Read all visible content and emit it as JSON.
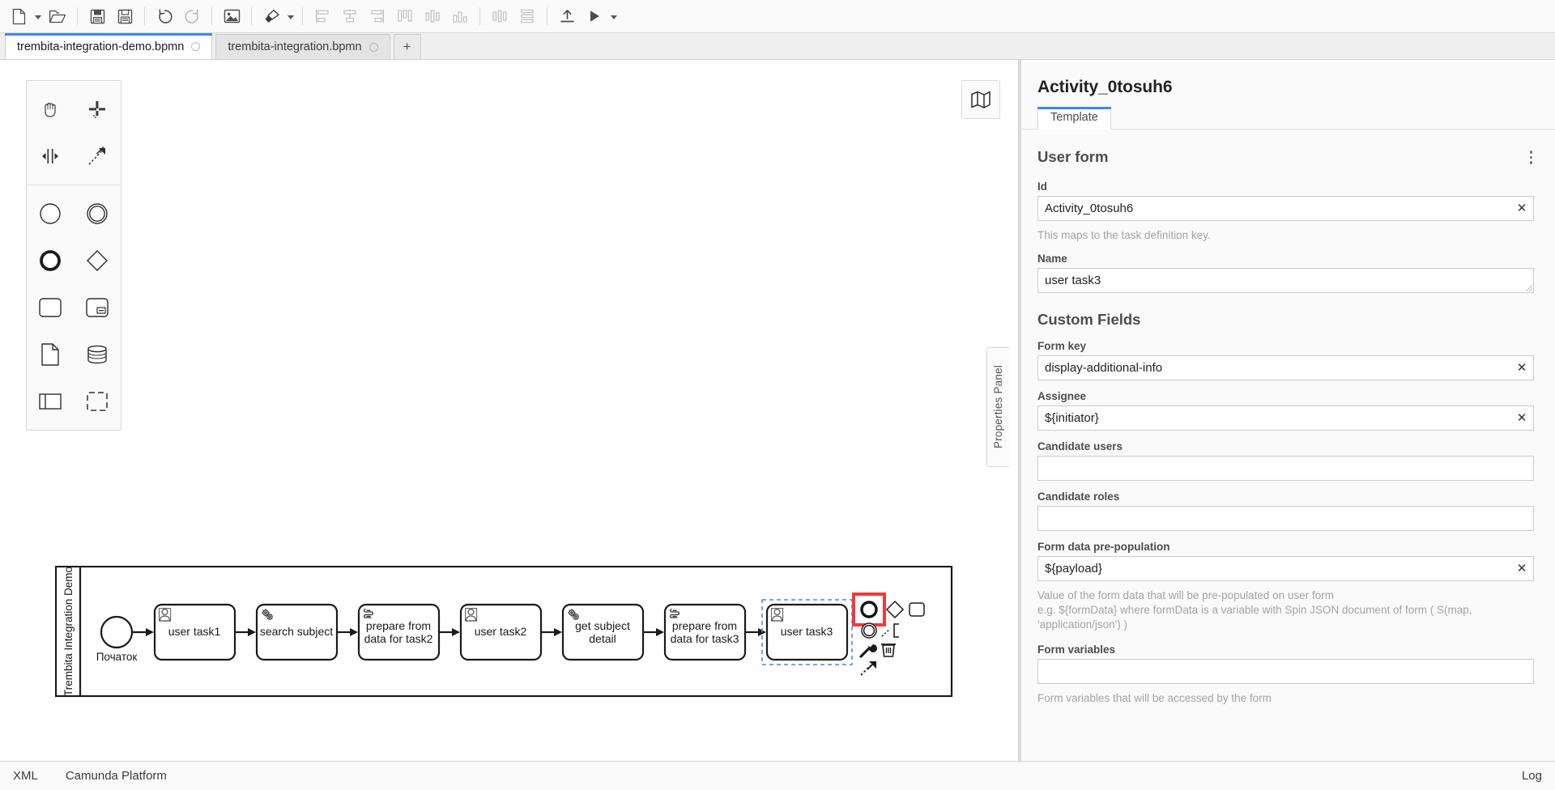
{
  "toolbar": {
    "buttons": [
      {
        "name": "new-file-button",
        "icon": "new-file-icon",
        "label": "New file"
      },
      {
        "name": "new-file-dropdown",
        "icon": "caret-down-icon",
        "label": "New file options"
      },
      {
        "name": "open-file-button",
        "icon": "open-folder-icon",
        "label": "Open file"
      },
      {
        "name": "save-button",
        "icon": "save-icon",
        "label": "Save"
      },
      {
        "name": "save-as-button",
        "icon": "save-as-icon",
        "label": "Save as"
      },
      {
        "name": "undo-button",
        "icon": "undo-icon",
        "label": "Undo"
      },
      {
        "name": "redo-button",
        "icon": "redo-icon",
        "label": "Redo"
      },
      {
        "name": "export-image-button",
        "icon": "image-icon",
        "label": "Export as image"
      },
      {
        "name": "set-color-button",
        "icon": "paintbrush-icon",
        "label": "Set color"
      },
      {
        "name": "set-color-dropdown",
        "icon": "caret-down-icon",
        "label": "Color options"
      },
      {
        "name": "align-left-button",
        "icon": "align-left-icon",
        "label": "Align left"
      },
      {
        "name": "align-center-button",
        "icon": "align-center-icon",
        "label": "Align center"
      },
      {
        "name": "align-right-button",
        "icon": "align-right-icon",
        "label": "Align right"
      },
      {
        "name": "align-top-button",
        "icon": "align-top-icon",
        "label": "Align top"
      },
      {
        "name": "align-middle-button",
        "icon": "align-middle-icon",
        "label": "Align middle"
      },
      {
        "name": "align-bottom-button",
        "icon": "align-bottom-icon",
        "label": "Align bottom"
      },
      {
        "name": "distribute-horizontal-button",
        "icon": "distribute-horizontal-icon",
        "label": "Distribute horizontally"
      },
      {
        "name": "distribute-vertical-button",
        "icon": "distribute-vertical-icon",
        "label": "Distribute vertically"
      },
      {
        "name": "deploy-button",
        "icon": "deploy-upload-icon",
        "label": "Deploy"
      },
      {
        "name": "start-process-button",
        "icon": "play-icon",
        "label": "Start process instance"
      },
      {
        "name": "start-process-dropdown",
        "icon": "caret-down-icon",
        "label": "Start options"
      }
    ]
  },
  "tabs": {
    "items": [
      {
        "label": "trembita-integration-demo.bpmn",
        "active": true
      },
      {
        "label": "trembita-integration.bpmn",
        "active": false
      }
    ],
    "add_label": "+"
  },
  "palette": {
    "groups": [
      {
        "tools": [
          {
            "name": "hand-tool",
            "icon": "hand-icon",
            "label": "Activate the hand tool"
          },
          {
            "name": "lasso-tool",
            "icon": "lasso-icon",
            "label": "Activate the lasso tool"
          },
          {
            "name": "space-tool",
            "icon": "space-tool-icon",
            "label": "Activate the create/remove space tool"
          },
          {
            "name": "connect-tool",
            "icon": "connect-icon",
            "label": "Activate the global connect tool"
          }
        ]
      },
      {
        "tools": [
          {
            "name": "create-start-event",
            "icon": "start-event-icon",
            "label": "Create StartEvent"
          },
          {
            "name": "create-intermediate-event",
            "icon": "intermediate-event-icon",
            "label": "Create Intermediate/Boundary Event"
          },
          {
            "name": "create-end-event",
            "icon": "end-event-icon",
            "label": "Create EndEvent"
          },
          {
            "name": "create-gateway",
            "icon": "gateway-icon",
            "label": "Create Gateway"
          },
          {
            "name": "create-task",
            "icon": "task-icon",
            "label": "Create Task"
          },
          {
            "name": "create-subprocess",
            "icon": "subprocess-icon",
            "label": "Create expanded SubProcess"
          },
          {
            "name": "create-data-object",
            "icon": "data-object-icon",
            "label": "Create DataObjectReference"
          },
          {
            "name": "create-data-store",
            "icon": "data-store-icon",
            "label": "Create DataStoreReference"
          },
          {
            "name": "create-pool",
            "icon": "pool-icon",
            "label": "Create Pool/Participant"
          },
          {
            "name": "create-group",
            "icon": "group-icon",
            "label": "Create Group"
          }
        ]
      }
    ]
  },
  "canvas": {
    "minimap_label": "Toggle minimap",
    "pool_label": "Trembita Integration Demo",
    "start_event_label": "Початок",
    "tasks": [
      {
        "label": "user task1",
        "type": "user"
      },
      {
        "label": "search subject",
        "type": "service"
      },
      {
        "label": "prepare from data for task2",
        "type": "script"
      },
      {
        "label": "user task2",
        "type": "user"
      },
      {
        "label": "get subject detail",
        "type": "service"
      },
      {
        "label": "prepare from data for task3",
        "type": "script"
      },
      {
        "label": "user task3",
        "type": "user",
        "selected": true
      }
    ],
    "context_pad": [
      {
        "name": "append-end-event",
        "icon": "end-event-icon",
        "label": "Append EndEvent",
        "highlighted": true
      },
      {
        "name": "append-gateway",
        "icon": "gateway-icon",
        "label": "Append Gateway"
      },
      {
        "name": "append-task",
        "icon": "task-icon",
        "label": "Append Task"
      },
      {
        "name": "append-intermediate-event",
        "icon": "intermediate-event-icon",
        "label": "Append Intermediate/Boundary Event"
      },
      {
        "name": "connect-element",
        "icon": "connect-icon",
        "label": "Connect using Sequence/MessageFlow or Association"
      },
      {
        "name": "change-type",
        "icon": "wrench-icon",
        "label": "Change element"
      },
      {
        "name": "delete-element",
        "icon": "trash-icon",
        "label": "Remove"
      },
      {
        "name": "append-text-annotation",
        "icon": "text-annotation-icon",
        "label": "Append TextAnnotation"
      },
      {
        "name": "append-connect-arrow",
        "icon": "connect-arrow-icon",
        "label": "Connect"
      }
    ],
    "highlight_color": "#ee3b3b",
    "selection_color": "#4285f4"
  },
  "properties_handle": {
    "label": "Properties Panel"
  },
  "properties": {
    "title": "Activity_0tosuh6",
    "tabs": [
      {
        "label": "Template",
        "active": true
      }
    ],
    "sections": [
      {
        "title": "User form",
        "menu_label": "Template options",
        "fields": [
          {
            "name": "id-field",
            "label": "Id",
            "value": "Activity_0tosuh6",
            "placeholder": "",
            "clearable": true,
            "hint": "This maps to the task definition key.",
            "kind": "input"
          },
          {
            "name": "name-field",
            "label": "Name",
            "value": "user task3",
            "placeholder": "",
            "clearable": false,
            "hint": "",
            "kind": "textarea"
          }
        ]
      },
      {
        "title": "Custom Fields",
        "menu_label": "",
        "fields": [
          {
            "name": "form-key-field",
            "label": "Form key",
            "value": "display-additional-info",
            "placeholder": "",
            "clearable": true,
            "hint": "",
            "kind": "input"
          },
          {
            "name": "assignee-field",
            "label": "Assignee",
            "value": "${initiator}",
            "placeholder": "",
            "clearable": true,
            "hint": "",
            "kind": "input"
          },
          {
            "name": "candidate-users-field",
            "label": "Candidate users",
            "value": "",
            "placeholder": "",
            "clearable": false,
            "hint": "",
            "kind": "input"
          },
          {
            "name": "candidate-roles-field",
            "label": "Candidate roles",
            "value": "",
            "placeholder": "",
            "clearable": false,
            "hint": "",
            "kind": "input"
          },
          {
            "name": "form-data-prepopulation-field",
            "label": "Form data pre-population",
            "value": "${payload}",
            "placeholder": "",
            "clearable": true,
            "hint": "Value of the form data that will be pre-populated on user form\ne.g. ${formData} where formData is a variable with Spin JSON document of form ( S(map, 'application/json') )",
            "kind": "input"
          },
          {
            "name": "form-variables-field",
            "label": "Form variables",
            "value": "",
            "placeholder": "",
            "clearable": false,
            "hint": "Form variables that will be accessed by the form",
            "kind": "input"
          }
        ]
      }
    ]
  },
  "footer": {
    "left_items": [
      {
        "name": "xml-tab",
        "label": "XML"
      },
      {
        "name": "camunda-platform-tab",
        "label": "Camunda Platform"
      }
    ],
    "right_items": [
      {
        "name": "log-button",
        "label": "Log"
      }
    ]
  }
}
